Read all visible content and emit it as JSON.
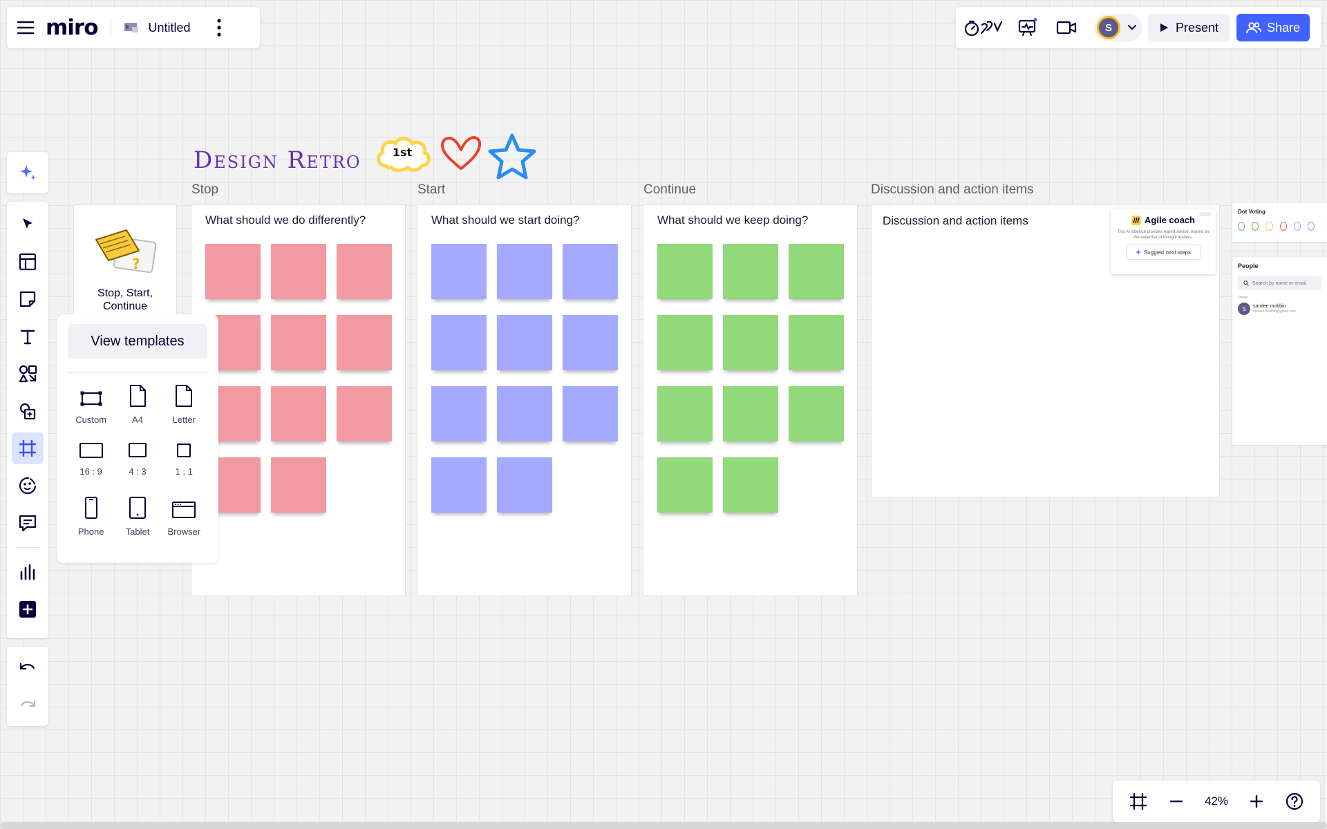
{
  "app": {
    "logo": "miro",
    "board_title": "Untitled"
  },
  "topbar_right": {
    "present_label": "Present",
    "share_label": "Share",
    "avatar_initial": "S"
  },
  "frame_panel": {
    "view_templates_label": "View templates",
    "frames": [
      {
        "label": "Custom",
        "icon": "custom-frame-icon"
      },
      {
        "label": "A4",
        "icon": "a4-frame-icon"
      },
      {
        "label": "Letter",
        "icon": "letter-frame-icon"
      },
      {
        "label": "16 : 9",
        "icon": "16-9-frame-icon"
      },
      {
        "label": "4 : 3",
        "icon": "4-3-frame-icon"
      },
      {
        "label": "1 : 1",
        "icon": "1-1-frame-icon"
      },
      {
        "label": "Phone",
        "icon": "phone-frame-icon"
      },
      {
        "label": "Tablet",
        "icon": "tablet-frame-icon"
      },
      {
        "label": "Browser",
        "icon": "browser-frame-icon"
      }
    ]
  },
  "template_card": {
    "label": "Stop, Start, Continue"
  },
  "board": {
    "title": "Design Retro",
    "badge_text": "1st",
    "columns": [
      {
        "label": "Stop",
        "question": "What should we do differently?",
        "color": "#f19aa2",
        "sticky_count": 11
      },
      {
        "label": "Start",
        "question": "What should we start doing?",
        "color": "#a3aaff",
        "sticky_count": 11
      },
      {
        "label": "Continue",
        "question": "What should we keep doing?",
        "color": "#91d97a",
        "sticky_count": 11
      }
    ],
    "discussion": {
      "label": "Discussion and action items",
      "title": "Discussion and action items"
    },
    "agile_coach": {
      "title": "Agile coach",
      "description": "This AI sidekick provides expert advice, trained on the expertise of thought leaders.",
      "button_label": "Suggest next steps"
    },
    "dot_voting": {
      "title": "Dot Voting",
      "colors": [
        "#5aa9e6",
        "#58b348",
        "#f5c46b",
        "#e8573f",
        "#a7a4f0",
        "#5aa9e6"
      ]
    },
    "people": {
      "title": "People",
      "search_placeholder": "Search by name or email",
      "online_label": "Online",
      "user_name": "samlee.mobbin",
      "user_email": "samlee.mobbin@gmail.com",
      "user_initial": "S"
    }
  },
  "zoom": {
    "level": "42%"
  }
}
